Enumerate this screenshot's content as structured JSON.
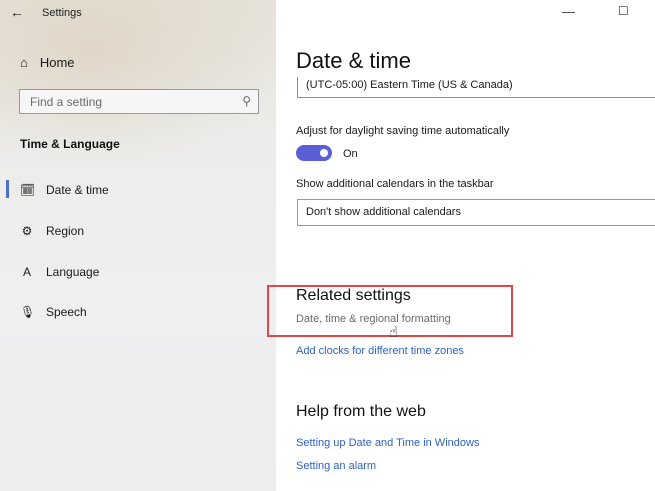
{
  "window": {
    "back_icon": "←",
    "title": "Settings",
    "minimize_icon": "—",
    "maximize_icon": "☐"
  },
  "sidebar": {
    "home_icon": "⌂",
    "home_label": "Home",
    "search_placeholder": "Find a setting",
    "search_icon": "⚲",
    "section_title": "Time & Language",
    "items": [
      {
        "icon": "🗓",
        "label": "Date & time"
      },
      {
        "icon": "⚙",
        "label": "Region"
      },
      {
        "icon": "A",
        "label": "Language"
      },
      {
        "icon": "🎙",
        "label": "Speech"
      }
    ],
    "active_index": 0,
    "accent_color": "#4a6fcf"
  },
  "main": {
    "heading": "Date & time",
    "timezone_value": "(UTC-05:00) Eastern Time (US & Canada)",
    "dst_label": "Adjust for daylight saving time automatically",
    "dst_toggle_state": "On",
    "toggle_color": "#5b5fd6",
    "calendars_label": "Show additional calendars in the taskbar",
    "calendars_value": "Don't show additional calendars",
    "related_title": "Related settings",
    "related_links": [
      "Date, time & regional formatting",
      "Add clocks for different time zones"
    ],
    "help_title": "Help from the web",
    "help_links": [
      "Setting up Date and Time in Windows",
      "Setting an alarm"
    ],
    "highlight_color": "#e04747"
  }
}
